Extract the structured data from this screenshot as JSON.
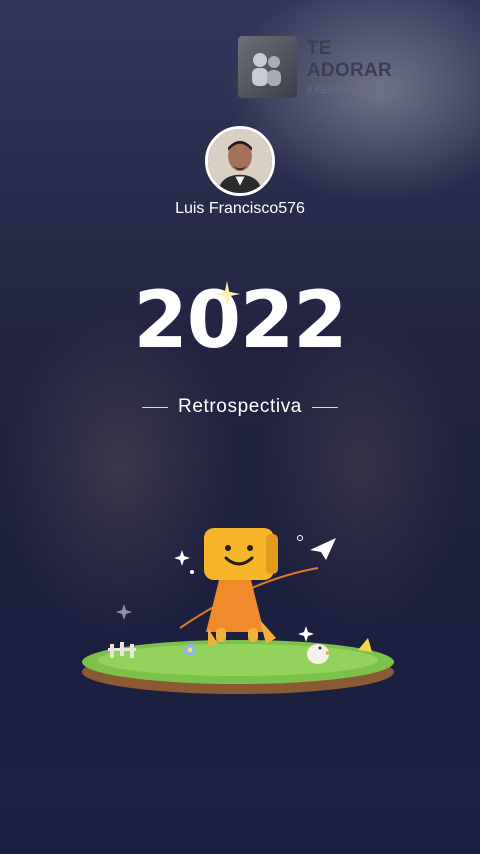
{
  "music": {
    "title": "TE ADORAR",
    "artist": "// FERNANDINHO",
    "icon": "album-cover"
  },
  "profile": {
    "username": "Luis Francisco576",
    "avatar_icon": "user-avatar"
  },
  "recap": {
    "year": "2022",
    "subtitle": "Retrospectiva"
  },
  "colors": {
    "text": "#ffffff",
    "mascot": "#f7b52a",
    "grass": "#7cc24a"
  }
}
